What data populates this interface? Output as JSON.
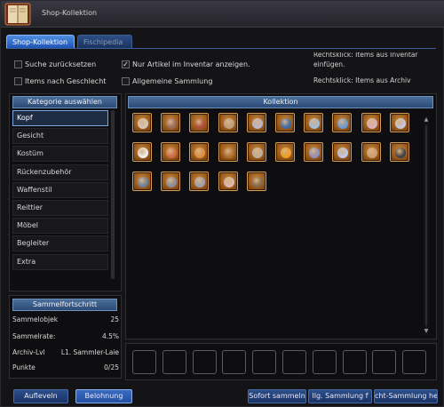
{
  "window": {
    "title": "Shop-Kollektion"
  },
  "tabs": [
    {
      "label": "Shop-Kollektion",
      "active": true
    },
    {
      "label": "Fischipedia",
      "active": false
    }
  ],
  "options": {
    "reset_search": {
      "label": "Suche zurücksetzen",
      "checked": false
    },
    "only_inventory": {
      "label": "Nur Artikel im Inventar anzeigen.",
      "checked": true
    },
    "by_gender": {
      "label": "Items nach Geschlecht",
      "checked": false
    },
    "general_collection": {
      "label": "Allgemeine Sammlung",
      "checked": false
    }
  },
  "hints": {
    "line1": "Rechtsklick: Items aus Inventar",
    "line2": "einfügen.",
    "line3": "Rechtsklick: Items aus Archiv"
  },
  "categories": {
    "header": "Kategorie auswählen",
    "items": [
      "Kopf",
      "Gesicht",
      "Kostüm",
      "Rückenzubehör",
      "Waffenstil",
      "Reittier",
      "Möbel",
      "Begleiter",
      "Extra"
    ],
    "selected": "Kopf"
  },
  "collection": {
    "header": "Kollektion",
    "item_count": 25,
    "empty_slot_count": 10
  },
  "progress": {
    "header": "Sammelfortschritt",
    "rows": [
      {
        "label": "Sammelobjek",
        "value": "25"
      },
      {
        "label": "Sammelrate:",
        "value": "4.5%"
      },
      {
        "label": "Archiv-Lvl",
        "value": "L1. Sammler-Laie"
      },
      {
        "label": "Punkte",
        "value": "0/25"
      }
    ]
  },
  "buttons": {
    "level_up": "Aufleveln",
    "reward": "Belohnung",
    "collect_now": "Sofort sammeln",
    "general_collection_fill": "llg. Sammlung f",
    "gender_collection": "cht-Sammlung he"
  },
  "colors": {
    "accent_blue": "#2c4b76",
    "item_frame": "#c78a3a",
    "selected_border": "#7aa4da"
  }
}
